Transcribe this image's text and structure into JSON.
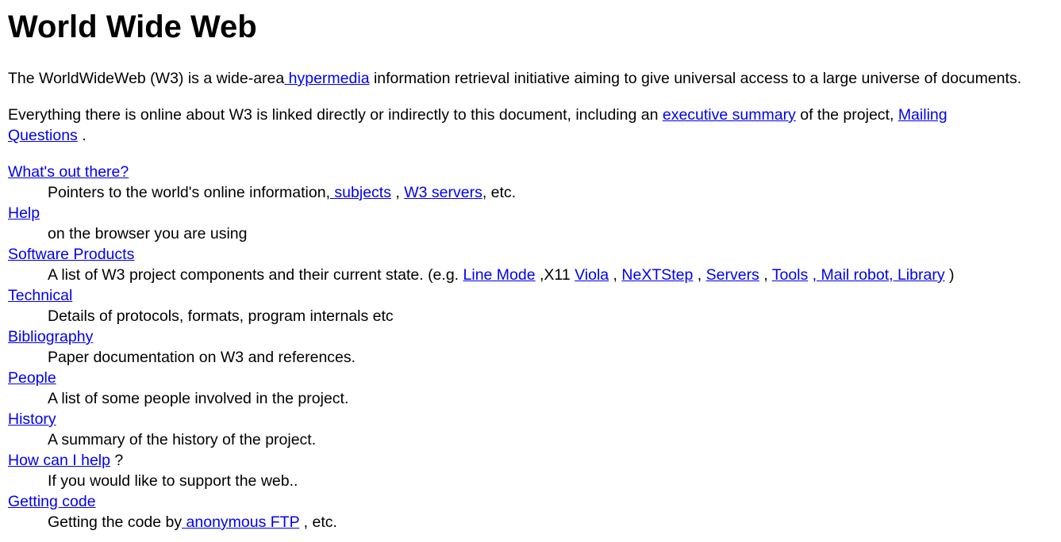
{
  "title": "World Wide Web",
  "intro": {
    "before": "The WorldWideWeb (W3) is a wide-area",
    "link": " hypermedia",
    "after": " information retrieval initiative aiming to give universal access to a large universe of documents."
  },
  "summary": {
    "before": "Everything there is online about W3 is linked directly or indirectly to this document, including an ",
    "link1": "executive summary",
    "mid": " of the project, ",
    "link2": "Mailing",
    "link3": "Questions",
    "after": " ."
  },
  "items": [
    {
      "term": "What's out there?",
      "desc_a": "Pointers to the world's online information,",
      "l1": " subjects",
      "s1": " , ",
      "l2": "W3 servers",
      "s2": ", etc."
    },
    {
      "term": "Help",
      "desc": "on the browser you are using"
    },
    {
      "term": "Software Products",
      "desc": "A list of W3 project components and their current state. (e.g. ",
      "links": [
        "Line Mode",
        "Viola",
        "NeXTStep",
        "Servers",
        "Tools",
        ", Mail robot",
        ", Library"
      ],
      "seps": [
        " ,X11 ",
        " , ",
        " , ",
        " , ",
        " ",
        "",
        " )"
      ]
    },
    {
      "term": "Technical",
      "desc": "Details of protocols, formats, program internals etc"
    },
    {
      "term": "Bibliography",
      "desc": "Paper documentation on W3 and references."
    },
    {
      "term": "People",
      "desc": "A list of some people involved in the project."
    },
    {
      "term": "History",
      "desc": "A summary of the history of the project."
    },
    {
      "term": "How can I help",
      "term_after": " ?",
      "desc": "If you would like to support the web.."
    },
    {
      "term": "Getting code",
      "desc": "Getting the code by",
      "link": " anonymous FTP",
      "after": " , etc."
    }
  ]
}
